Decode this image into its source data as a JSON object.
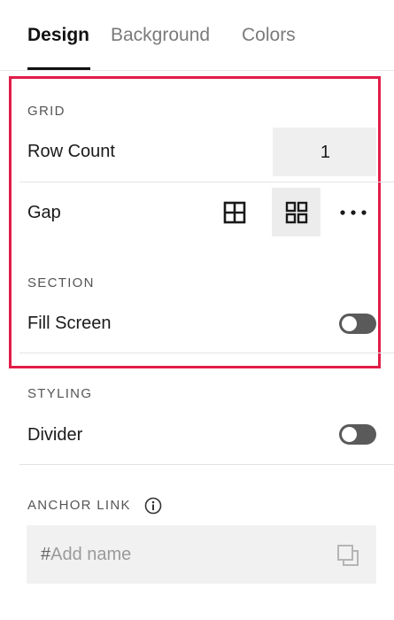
{
  "tabs": [
    {
      "label": "Design",
      "active": true
    },
    {
      "label": "Background",
      "active": false
    },
    {
      "label": "Colors",
      "active": false
    }
  ],
  "grid": {
    "section_label": "GRID",
    "row_count_label": "Row Count",
    "row_count_value": "1",
    "gap_label": "Gap",
    "gap_options": [
      {
        "icon": "grid-no-gap-icon",
        "selected": false
      },
      {
        "icon": "grid-with-gap-icon",
        "selected": true
      },
      {
        "icon": "more-options-icon",
        "selected": false
      }
    ]
  },
  "section": {
    "section_label": "SECTION",
    "fill_screen_label": "Fill Screen",
    "fill_screen_on": false
  },
  "styling": {
    "section_label": "STYLING",
    "divider_label": "Divider",
    "divider_on": false
  },
  "anchor_link": {
    "section_label": "ANCHOR LINK",
    "info_icon": "info-icon",
    "prefix": "#",
    "placeholder": "Add name",
    "copy_icon": "copy-icon"
  },
  "colors": {
    "highlight_border": "#e11d48",
    "toggle_off": "#5a5a5a",
    "field_background": "#efefef"
  }
}
